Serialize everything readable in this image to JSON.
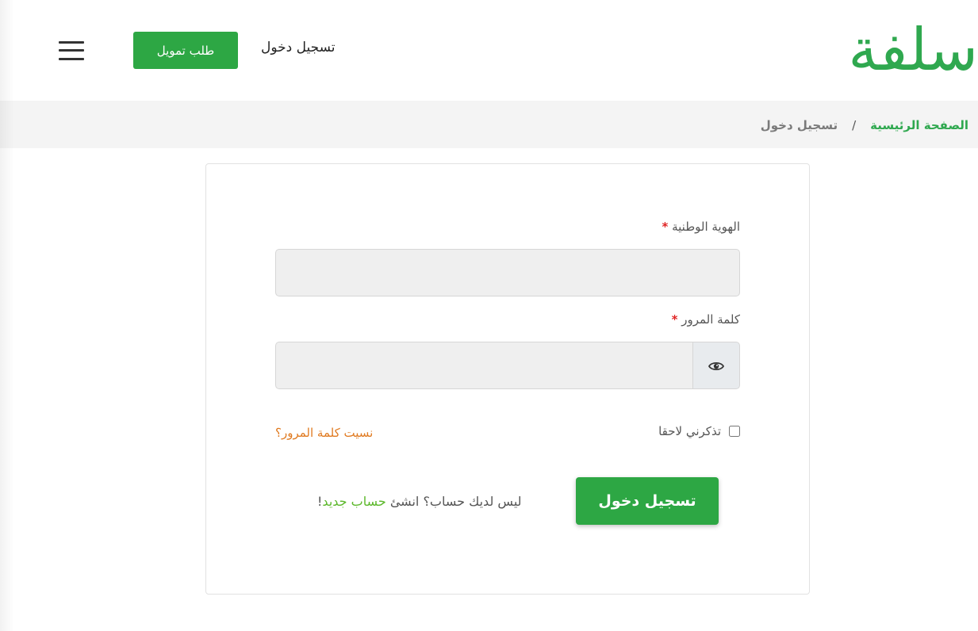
{
  "header": {
    "logo_text": "سلفة",
    "login_link": "تسجيل دخول",
    "finance_button": "طلب تمويل"
  },
  "breadcrumb": {
    "home": "الصفحة الرئيسية",
    "separator": "/",
    "current": "تسجيل دخول"
  },
  "form": {
    "national_id_label": "الهوية الوطنية",
    "password_label": "كلمة المرور",
    "required_marker": "*",
    "national_id_value": "",
    "password_value": "",
    "remember_label": "تذكرني لاحقا",
    "forgot_link": "نسيت كلمة المرور؟",
    "submit_label": "تسجيل دخول",
    "signup_prefix": "ليس لديك حساب؟ انشئ",
    "signup_link": "حساب جديد",
    "signup_suffix": "!"
  },
  "colors": {
    "brand_green": "#2da744",
    "forgot_orange": "#e07a20",
    "link_green": "#5cb82b",
    "required_red": "#e02424"
  },
  "icons": {
    "menu": "hamburger-menu-icon",
    "password_toggle": "eye-icon"
  }
}
